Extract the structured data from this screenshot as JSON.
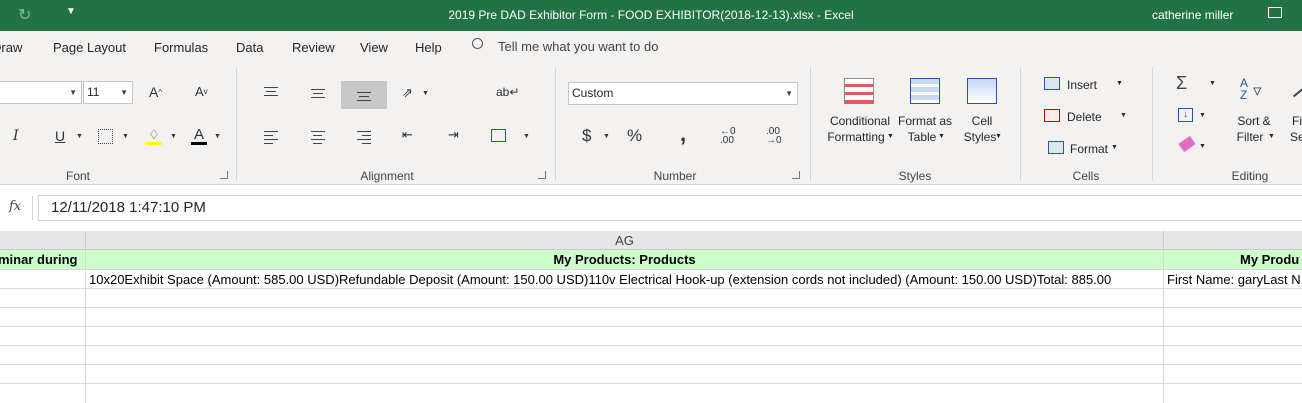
{
  "titlebar": {
    "title": "2019 Pre DAD Exhibitor Form - FOOD EXHIBITOR(2018-12-13).xlsx  -  Excel",
    "user": "catherine miller",
    "accent": "#217346"
  },
  "menu": {
    "tabs": [
      "Draw",
      "Page Layout",
      "Formulas",
      "Data",
      "Review",
      "View",
      "Help"
    ],
    "tell_me": "Tell me what you want to do"
  },
  "ribbon": {
    "font": {
      "name_value": "",
      "size_value": "11",
      "label": "Font"
    },
    "alignment": {
      "label": "Alignment"
    },
    "number": {
      "format_value": "Custom",
      "currency": "$",
      "percent": "%",
      "comma": ",",
      "label": "Number"
    },
    "styles": {
      "conditional": [
        "Conditional",
        "Formatting"
      ],
      "format_table": [
        "Format as",
        "Table"
      ],
      "cell_styles": [
        "Cell",
        "Styles"
      ],
      "label": "Styles"
    },
    "cells": {
      "insert": "Insert",
      "delete": "Delete",
      "format": "Format",
      "label": "Cells"
    },
    "editing": {
      "sort": [
        "Sort &",
        "Filter"
      ],
      "find": [
        "Fi",
        "Se"
      ],
      "label": "Editing"
    }
  },
  "formula_bar": {
    "fx": "fx",
    "value": "12/11/2018  1:47:10 PM"
  },
  "grid": {
    "columns": [
      "AG"
    ],
    "headers": [
      "minar during",
      "My Products: Products",
      "My Produ"
    ],
    "row1": [
      "",
      "10x20Exhibit Space  (Amount: 585.00 USD)Refundable Deposit (Amount: 150.00 USD)110v Electrical Hook-up (extension cords not included) (Amount: 150.00 USD)Total: 885.00",
      "First Name: garyLast N"
    ]
  }
}
